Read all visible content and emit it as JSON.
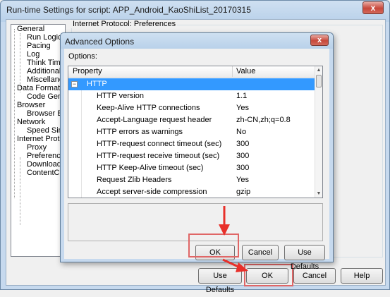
{
  "window": {
    "title": "Run-time Settings for script: APP_Android_KaoShiList_20170315",
    "close_glyph": "x"
  },
  "tree": {
    "items": [
      {
        "label": "General",
        "level": 0
      },
      {
        "label": "Run Logic",
        "level": 1
      },
      {
        "label": "Pacing",
        "level": 1
      },
      {
        "label": "Log",
        "level": 1
      },
      {
        "label": "Think Time",
        "level": 1
      },
      {
        "label": "Additional att",
        "level": 1
      },
      {
        "label": "Miscellaneou",
        "level": 1
      },
      {
        "label": "Data Format Ext",
        "level": 0
      },
      {
        "label": "Code Genera",
        "level": 1
      },
      {
        "label": "Browser",
        "level": 0
      },
      {
        "label": "Browser Emu",
        "level": 1
      },
      {
        "label": "Network",
        "level": 0
      },
      {
        "label": "Speed Simula",
        "level": 1
      },
      {
        "label": "Internet Protoco",
        "level": 0
      },
      {
        "label": "Proxy",
        "level": 1
      },
      {
        "label": "Preferences",
        "level": 1
      },
      {
        "label": "Download Fil",
        "level": 1
      },
      {
        "label": "ContentChec",
        "level": 1
      }
    ]
  },
  "preferences": {
    "group_title": "Internet Protocol: Preferences"
  },
  "footer": {
    "use_defaults_label": "Use Defaults",
    "ok_label": "OK",
    "cancel_label": "Cancel",
    "help_label": "Help"
  },
  "advanced": {
    "title": "Advanced Options",
    "close_glyph": "x",
    "options_label": "Options:",
    "columns": {
      "property": "Property",
      "value": "Value"
    },
    "section": {
      "label": "HTTP",
      "toggle": "−"
    },
    "rows": [
      {
        "property": "HTTP version",
        "value": "1.1"
      },
      {
        "property": "Keep-Alive HTTP connections",
        "value": "Yes"
      },
      {
        "property": "Accept-Language request header",
        "value": "zh-CN,zh;q=0.8"
      },
      {
        "property": "HTTP errors as warnings",
        "value": "No"
      },
      {
        "property": "HTTP-request connect timeout (sec)",
        "value": "300"
      },
      {
        "property": "HTTP-request receive timeout (sec)",
        "value": "300"
      },
      {
        "property": "HTTP Keep-Alive timeout (sec)",
        "value": "300"
      },
      {
        "property": "Request Zlib Headers",
        "value": "Yes"
      },
      {
        "property": "Accept server-side compression",
        "value": "gzip"
      }
    ],
    "ok_label": "OK",
    "cancel_label": "Cancel",
    "use_defaults_label": "Use Defaults"
  },
  "colors": {
    "selection": "#3399ff",
    "highlight": "#e06666",
    "arrow": "#e8302a"
  }
}
